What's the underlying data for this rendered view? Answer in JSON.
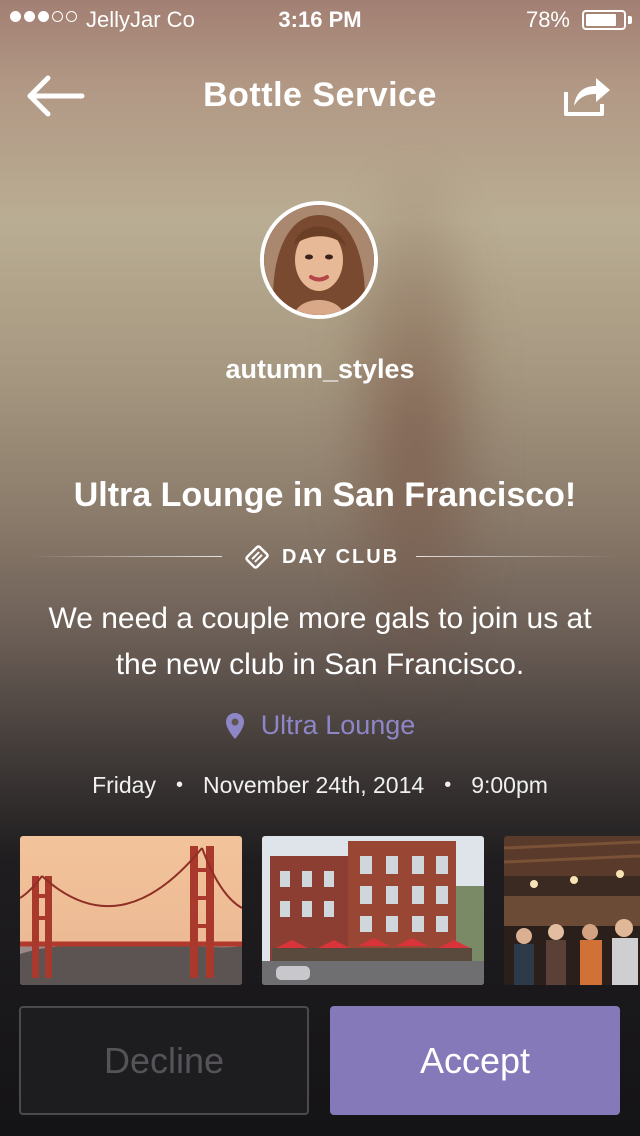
{
  "status_bar": {
    "carrier": "JellyJar Co",
    "time": "3:16 PM",
    "battery": "78%",
    "battery_level": 0.78,
    "signal_bars_filled": 3,
    "signal_bars_total": 5
  },
  "nav": {
    "title": "Bottle Service",
    "back_icon": "arrow-left-icon",
    "share_icon": "share-icon"
  },
  "profile": {
    "username": "autumn_styles"
  },
  "event": {
    "title": "Ultra Lounge in San Francisco!",
    "category": "DAY CLUB",
    "category_icon": "tag-icon",
    "description": "We need a couple more gals to join us at the new club in San Francisco.",
    "location": "Ultra Lounge",
    "location_icon": "map-pin-icon",
    "day": "Friday",
    "date": "November 24th, 2014",
    "time": "9:00pm",
    "separator": "•"
  },
  "photos": [
    {
      "subject": "golden-gate-bridge-photo"
    },
    {
      "subject": "brick-building-cafe-photo"
    },
    {
      "subject": "bar-interior-photo"
    }
  ],
  "actions": {
    "decline_label": "Decline",
    "accept_label": "Accept"
  },
  "colors": {
    "accent": "#8679b9",
    "location_text": "#8e86c6",
    "decline_text": "#555358"
  }
}
